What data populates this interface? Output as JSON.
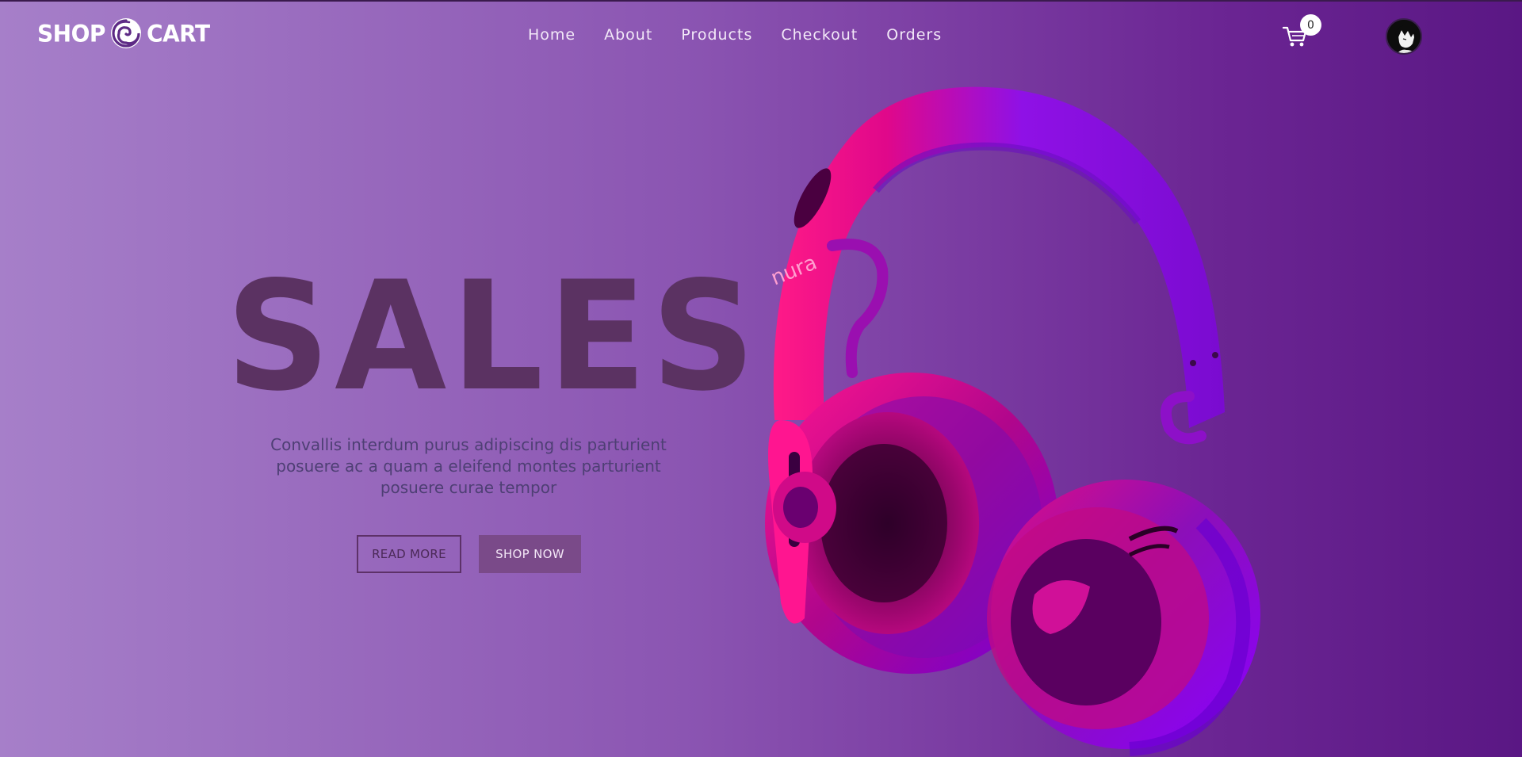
{
  "brand": {
    "left": "SHOP",
    "right": "CART"
  },
  "nav": {
    "items": [
      "Home",
      "About",
      "Products",
      "Checkout",
      "Orders"
    ]
  },
  "cart": {
    "count": "0"
  },
  "hero": {
    "title": "SALES",
    "description": "Convallis interdum purus adipiscing dis parturient posuere ac a quam a eleifend montes parturient posuere curae tempor",
    "read_more": "READ MORE",
    "shop_now": "SHOP NOW",
    "product_brand": "nura"
  },
  "colors": {
    "gradient_start": "#a67fc9",
    "gradient_end": "#5a1784",
    "title": "#5b3262",
    "shop_button": "#7a4a89",
    "headphone_pink": "#ff0a82",
    "headphone_purple": "#8a00ff"
  },
  "icons": [
    "logo-swirl-icon",
    "cart-icon",
    "avatar-icon"
  ]
}
